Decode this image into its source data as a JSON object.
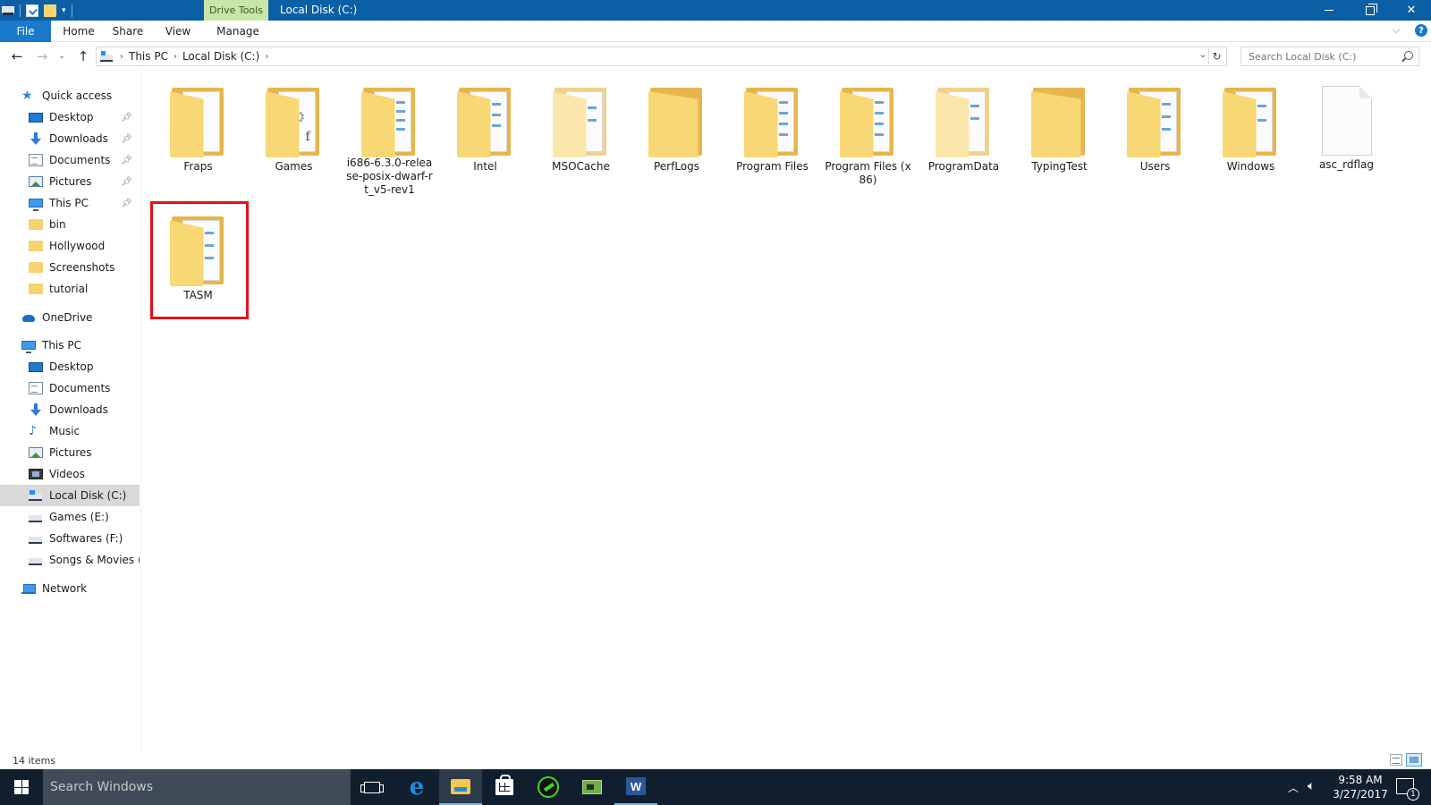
{
  "window": {
    "title": "Local Disk (C:)",
    "context_tab": "Drive Tools"
  },
  "ribbon": {
    "tabs": [
      {
        "label": "File"
      },
      {
        "label": "Home"
      },
      {
        "label": "Share"
      },
      {
        "label": "View"
      },
      {
        "label": "Manage"
      }
    ]
  },
  "address": {
    "crumbs": [
      "This PC",
      "Local Disk (C:)"
    ],
    "search_placeholder": "Search Local Disk (C:)"
  },
  "nav": {
    "quick_access": {
      "label": "Quick access",
      "items": [
        {
          "label": "Desktop",
          "icon": "desktop-icon",
          "pinned": true
        },
        {
          "label": "Downloads",
          "icon": "downloads-icon",
          "pinned": true
        },
        {
          "label": "Documents",
          "icon": "documents-icon",
          "pinned": true
        },
        {
          "label": "Pictures",
          "icon": "pictures-icon",
          "pinned": true
        },
        {
          "label": "This PC",
          "icon": "this-pc-icon",
          "pinned": true
        },
        {
          "label": "bin",
          "icon": "folder-icon",
          "pinned": false
        },
        {
          "label": "Hollywood",
          "icon": "folder-icon",
          "pinned": false
        },
        {
          "label": "Screenshots",
          "icon": "folder-icon",
          "pinned": false
        },
        {
          "label": "tutorial",
          "icon": "folder-icon",
          "pinned": false
        }
      ]
    },
    "onedrive": {
      "label": "OneDrive"
    },
    "this_pc": {
      "label": "This PC",
      "items": [
        {
          "label": "Desktop",
          "icon": "desktop-icon"
        },
        {
          "label": "Documents",
          "icon": "documents-icon"
        },
        {
          "label": "Downloads",
          "icon": "downloads-icon"
        },
        {
          "label": "Music",
          "icon": "music-icon"
        },
        {
          "label": "Pictures",
          "icon": "pictures-icon"
        },
        {
          "label": "Videos",
          "icon": "videos-icon"
        },
        {
          "label": "Local Disk (C:)",
          "icon": "drive-c-icon",
          "selected": true
        },
        {
          "label": "Games (E:)",
          "icon": "drive-icon"
        },
        {
          "label": "Softwares (F:)",
          "icon": "drive-icon"
        },
        {
          "label": "Songs & Movies (G:",
          "icon": "drive-icon"
        }
      ]
    },
    "network": {
      "label": "Network"
    }
  },
  "items": [
    {
      "name": "Fraps",
      "type": "folder"
    },
    {
      "name": "Games",
      "type": "folder"
    },
    {
      "name": "i686-6.3.0-release-posix-dwarf-rt_v5-rev1",
      "type": "folder"
    },
    {
      "name": "Intel",
      "type": "folder"
    },
    {
      "name": "MSOCache",
      "type": "folder-hidden"
    },
    {
      "name": "PerfLogs",
      "type": "folder-empty"
    },
    {
      "name": "Program Files",
      "type": "folder"
    },
    {
      "name": "Program Files (x86)",
      "type": "folder"
    },
    {
      "name": "ProgramData",
      "type": "folder-hidden"
    },
    {
      "name": "TypingTest",
      "type": "folder-empty"
    },
    {
      "name": "Users",
      "type": "folder"
    },
    {
      "name": "Windows",
      "type": "folder"
    },
    {
      "name": "asc_rdflag",
      "type": "file"
    },
    {
      "name": "TASM",
      "type": "folder",
      "highlighted": true
    }
  ],
  "status": {
    "item_count": "14 items"
  },
  "taskbar": {
    "search_placeholder": "Search Windows",
    "time": "9:58 AM",
    "date": "3/27/2017",
    "notification_count": "1",
    "pinned_apps": [
      "task-view-icon",
      "edge-icon",
      "file-explorer-icon",
      "store-icon",
      "razer-icon",
      "hardware-monitor-icon",
      "word-icon"
    ]
  },
  "colors": {
    "titlebar": "#0b5fa5",
    "file_tab": "#1979ca",
    "context_tab": "#c7e6a8",
    "highlight": "#e0121c",
    "taskbar": "#101e2e"
  }
}
